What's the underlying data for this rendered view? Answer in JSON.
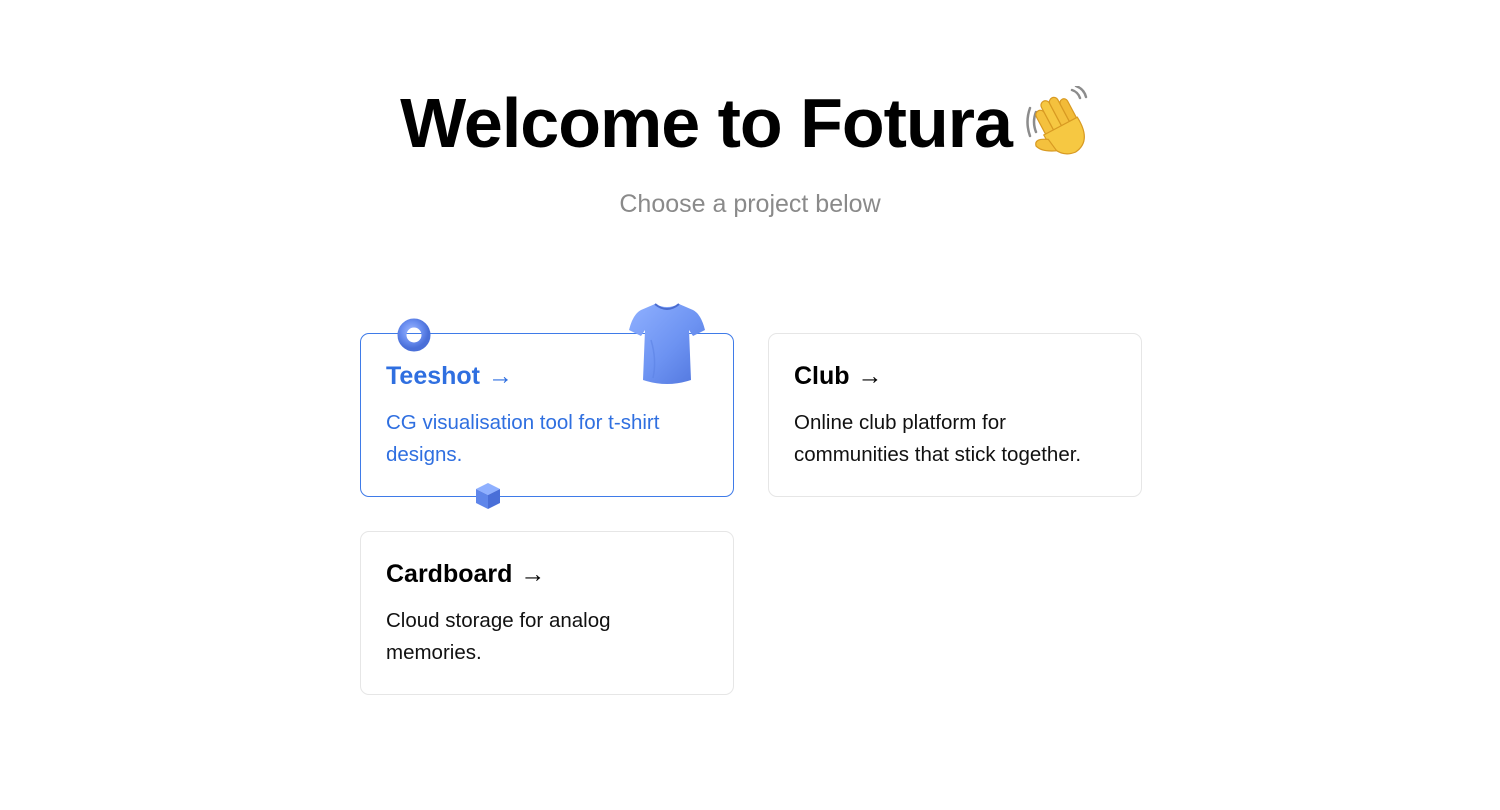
{
  "header": {
    "title": "Welcome to Fotura",
    "title_emoji": "waving-hand-icon",
    "subtitle": "Choose a project below"
  },
  "projects": [
    {
      "title": "Teeshot",
      "arrow": "→",
      "description": "CG visualisation tool for t-shirt designs.",
      "state": "hovered"
    },
    {
      "title": "Club",
      "arrow": "→",
      "description": "Online club platform for communities that stick together."
    },
    {
      "title": "Cardboard",
      "arrow": "→",
      "description": "Cloud storage for analog memories."
    }
  ],
  "decorations": [
    "torus-icon",
    "t-shirt-icon",
    "cube-icon"
  ],
  "colors": {
    "accent": "#3f7be8",
    "text": "#000000",
    "subtitle": "#8a8a8a",
    "card_border": "#e6e6e6"
  }
}
